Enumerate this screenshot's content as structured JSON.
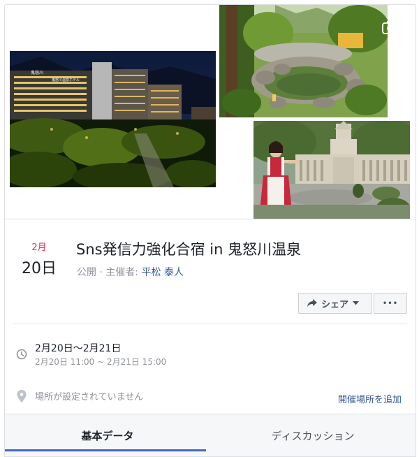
{
  "cover": {
    "photos": [
      {
        "name": "hotel-night-photo"
      },
      {
        "name": "hot-spring-photo"
      },
      {
        "name": "diet-building-photo"
      }
    ],
    "camera_icon": "camera-icon",
    "hotel_signs": [
      "鬼怒川",
      "鬼怒川温泉ホテル"
    ]
  },
  "event": {
    "month": "2月",
    "day": "20日",
    "title": "Sns発信力強化合宿 in 鬼怒川温泉",
    "privacy": "公開",
    "separator": " · ",
    "host_prefix": "主催者: ",
    "host": "平松 泰人"
  },
  "actions": {
    "share_label": "シェア",
    "more_label": "•••",
    "icons": {
      "share": "share-arrow-icon",
      "dropdown": "caret-down-icon"
    }
  },
  "details": {
    "date_range": "2月20日〜2月21日",
    "time_range": "2月20日 11:00 ~ 2月21日 15:00",
    "location_text": "場所が設定されていません",
    "add_location_label": "開催場所を追加",
    "icons": {
      "clock": "clock-icon",
      "location": "location-pin-icon"
    }
  },
  "tabs": [
    {
      "label": "基本データ",
      "active": true
    },
    {
      "label": "ディスカッション",
      "active": false
    }
  ],
  "colors": {
    "month": "#f02849",
    "link": "#365899",
    "tab_indicator": "#4267b2",
    "muted_text": "#90949c"
  }
}
